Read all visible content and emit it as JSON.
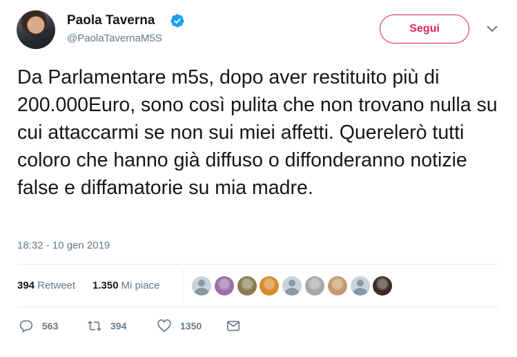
{
  "author": {
    "name": "Paola Taverna",
    "handle": "@PaolaTavernaM5S",
    "verified": true
  },
  "follow_button": {
    "label": "Segui",
    "color": "#e0245e"
  },
  "tweet": {
    "text": "Da Parlamentare m5s, dopo aver restituito più di 200.000Euro, sono così pulita che non trovano nulla su cui attaccarmi se non sui miei affetti. Querelerò tutti coloro che hanno già diffuso o diffonderanno notizie false e diffamatorie su mia madre.",
    "timestamp": "18:32 - 10 gen 2019"
  },
  "stats": {
    "retweets": {
      "count": "394",
      "label": "Retweet"
    },
    "likes": {
      "count": "1.350",
      "label": "Mi piace"
    }
  },
  "likers": [
    {
      "kind": "default"
    },
    {
      "kind": "photo",
      "color": "#9b6ea8"
    },
    {
      "kind": "photo",
      "color": "#8a7b55"
    },
    {
      "kind": "photo",
      "color": "#d9892a"
    },
    {
      "kind": "default"
    },
    {
      "kind": "photo",
      "color": "#a8a8a8"
    },
    {
      "kind": "photo",
      "color": "#c49a6c"
    },
    {
      "kind": "default"
    },
    {
      "kind": "photo",
      "color": "#3a2e26"
    }
  ],
  "actions": {
    "reply": {
      "icon": "reply-icon",
      "count": "563"
    },
    "retweet": {
      "icon": "retweet-icon",
      "count": "394"
    },
    "like": {
      "icon": "heart-icon",
      "count": "1350"
    },
    "message": {
      "icon": "envelope-icon"
    }
  },
  "colors": {
    "text": "#14171a",
    "secondary": "#657786",
    "verified": "#1da1f2",
    "divider": "#e6ecf0"
  }
}
